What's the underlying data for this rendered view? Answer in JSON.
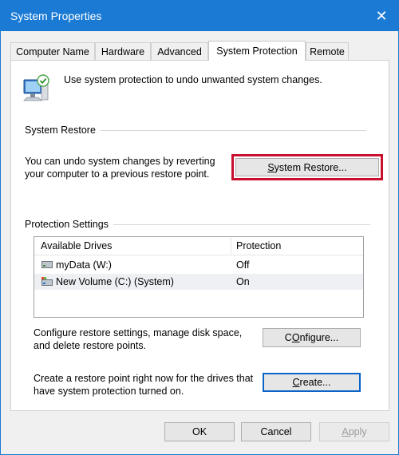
{
  "window": {
    "title": "System Properties",
    "close_glyph": "✕"
  },
  "tabs": [
    {
      "label": "Computer Name",
      "active": false
    },
    {
      "label": "Hardware",
      "active": false
    },
    {
      "label": "Advanced",
      "active": false
    },
    {
      "label": "System Protection",
      "active": true
    },
    {
      "label": "Remote",
      "active": false
    }
  ],
  "intro": {
    "icon": "system-protection-icon",
    "text": "Use system protection to undo unwanted system changes."
  },
  "system_restore": {
    "group_label": "System Restore",
    "description_line1": "You can undo system changes by reverting",
    "description_line2": "your computer to a previous restore point.",
    "button_accel": "S",
    "button_rest": "ystem Restore...",
    "highlight_color": "#c8102e"
  },
  "protection_settings": {
    "group_label": "Protection Settings",
    "columns": {
      "drive": "Available Drives",
      "protection": "Protection"
    },
    "drives": [
      {
        "name": "myData (W:)",
        "protection": "Off",
        "icon": "drive-icon"
      },
      {
        "name": "New Volume (C:) (System)",
        "protection": "On",
        "icon": "system-drive-icon"
      }
    ],
    "configure": {
      "description_line1": "Configure restore settings, manage disk space,",
      "description_line2": "and delete restore points.",
      "button_accel": "O",
      "button_prefix": "C",
      "button_rest": "nfigure..."
    },
    "create": {
      "description_line1": "Create a restore point right now for the drives that",
      "description_line2": "have system protection turned on.",
      "button_accel": "C",
      "button_rest": "reate..."
    }
  },
  "footer": {
    "ok": "OK",
    "cancel": "Cancel",
    "apply_accel": "A",
    "apply_rest": "pply"
  },
  "colors": {
    "titlebar": "#1a7ad4",
    "focus": "#0a64c8"
  }
}
